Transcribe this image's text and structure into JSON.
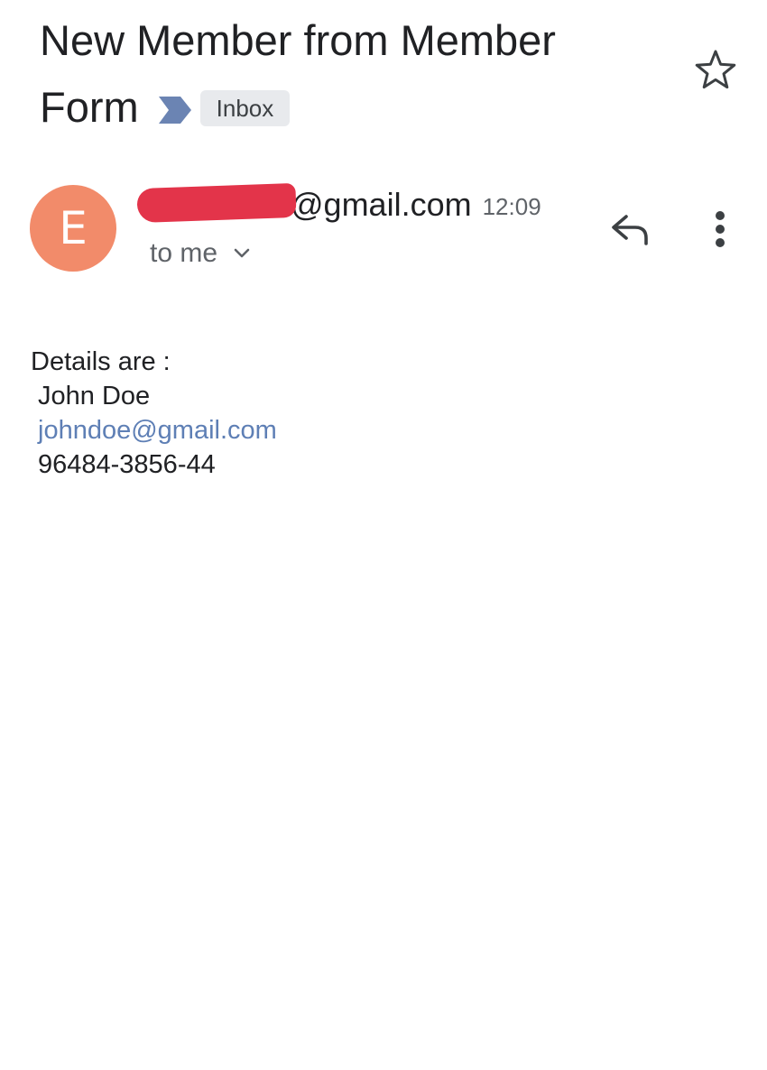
{
  "header": {
    "subject": "New Member from Member Form",
    "label": "Inbox",
    "importance_icon": "importance-marker-icon",
    "star_icon": "star-outline-icon"
  },
  "sender": {
    "avatar_initial": "E",
    "avatar_color": "#f28b6a",
    "address_visible": "@gmail.com",
    "redaction_color": "#e3344a",
    "time": "12:09",
    "recipient": "to me",
    "recipient_toggle_icon": "chevron-down-icon",
    "reply_icon": "reply-icon",
    "more_icon": "more-vert-icon"
  },
  "body": {
    "intro": "Details are :",
    "name": "John Doe",
    "email": "johndoe@gmail.com",
    "phone": "96484-3856-44"
  },
  "colors": {
    "link": "#5e7fb5",
    "importance_marker": "#6b84b3",
    "chip_background": "#e8eaed"
  }
}
